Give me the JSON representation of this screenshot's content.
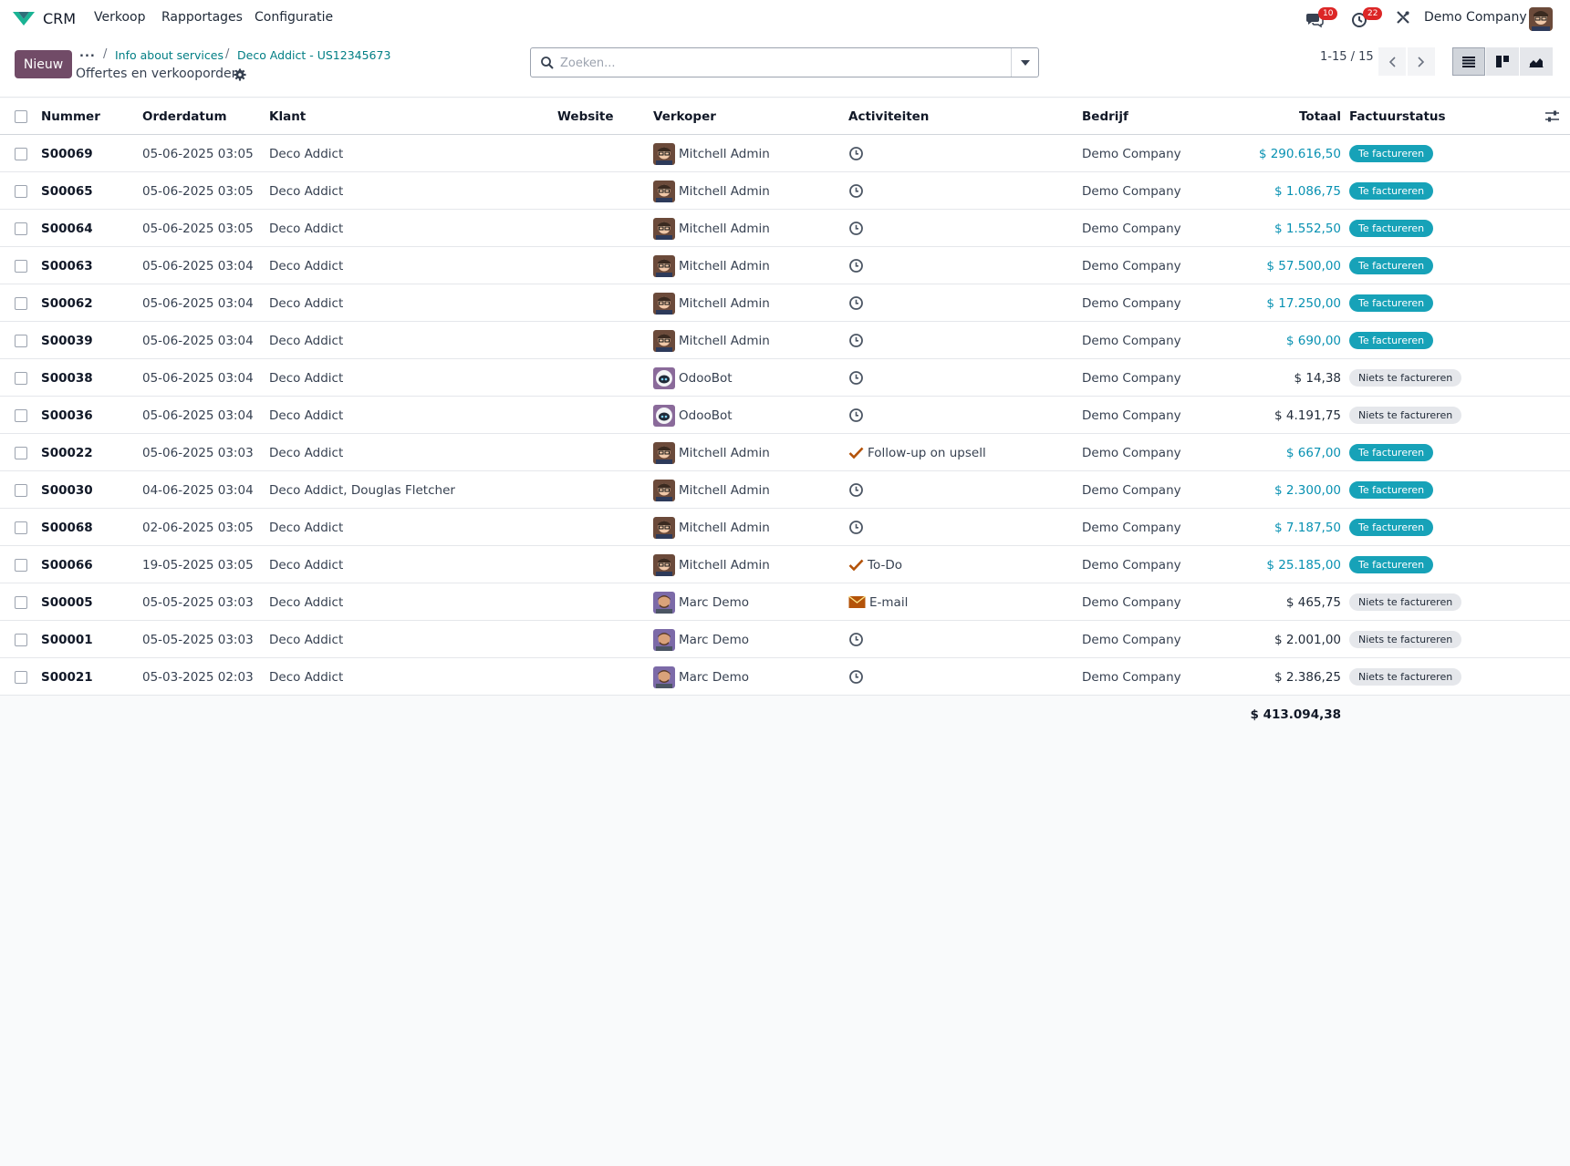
{
  "app": {
    "name": "CRM",
    "menus": [
      "Verkoop",
      "Rapportages",
      "Configuratie"
    ],
    "messages_count": "10",
    "activities_count": "22",
    "company": "Demo Company"
  },
  "control": {
    "new_label": "Nieuw",
    "breadcrumb_dots": "...",
    "breadcrumbs": [
      "Info about services",
      "Deco Addict - US12345673"
    ],
    "title": "Offertes en verkooporders",
    "search_placeholder": "Zoeken...",
    "pager": "1-15 / 15"
  },
  "table": {
    "headers": {
      "number": "Nummer",
      "date": "Orderdatum",
      "customer": "Klant",
      "website": "Website",
      "salesperson": "Verkoper",
      "activities": "Activiteiten",
      "company": "Bedrijf",
      "total": "Totaal",
      "invoice_status": "Factuurstatus"
    },
    "rows": [
      {
        "number": "S00069",
        "date": "05-06-2025 03:05",
        "customer": "Deco Addict",
        "website": "",
        "salesperson": "Mitchell Admin",
        "avatar": "mitchell",
        "activity": "",
        "activity_icon": "clock-icon",
        "company": "Demo Company",
        "total": "$ 290.616,50",
        "status": "Te factureren",
        "status_type": "info"
      },
      {
        "number": "S00065",
        "date": "05-06-2025 03:05",
        "customer": "Deco Addict",
        "website": "",
        "salesperson": "Mitchell Admin",
        "avatar": "mitchell",
        "activity": "",
        "activity_icon": "clock-icon",
        "company": "Demo Company",
        "total": "$ 1.086,75",
        "status": "Te factureren",
        "status_type": "info"
      },
      {
        "number": "S00064",
        "date": "05-06-2025 03:05",
        "customer": "Deco Addict",
        "website": "",
        "salesperson": "Mitchell Admin",
        "avatar": "mitchell",
        "activity": "",
        "activity_icon": "clock-icon",
        "company": "Demo Company",
        "total": "$ 1.552,50",
        "status": "Te factureren",
        "status_type": "info"
      },
      {
        "number": "S00063",
        "date": "05-06-2025 03:04",
        "customer": "Deco Addict",
        "website": "",
        "salesperson": "Mitchell Admin",
        "avatar": "mitchell",
        "activity": "",
        "activity_icon": "clock-icon",
        "company": "Demo Company",
        "total": "$ 57.500,00",
        "status": "Te factureren",
        "status_type": "info"
      },
      {
        "number": "S00062",
        "date": "05-06-2025 03:04",
        "customer": "Deco Addict",
        "website": "",
        "salesperson": "Mitchell Admin",
        "avatar": "mitchell",
        "activity": "",
        "activity_icon": "clock-icon",
        "company": "Demo Company",
        "total": "$ 17.250,00",
        "status": "Te factureren",
        "status_type": "info"
      },
      {
        "number": "S00039",
        "date": "05-06-2025 03:04",
        "customer": "Deco Addict",
        "website": "",
        "salesperson": "Mitchell Admin",
        "avatar": "mitchell",
        "activity": "",
        "activity_icon": "clock-icon",
        "company": "Demo Company",
        "total": "$ 690,00",
        "status": "Te factureren",
        "status_type": "info"
      },
      {
        "number": "S00038",
        "date": "05-06-2025 03:04",
        "customer": "Deco Addict",
        "website": "",
        "salesperson": "OdooBot",
        "avatar": "odoobot",
        "activity": "",
        "activity_icon": "clock-icon",
        "company": "Demo Company",
        "total": "$ 14,38",
        "status": "Niets te factureren",
        "status_type": "neutral"
      },
      {
        "number": "S00036",
        "date": "05-06-2025 03:04",
        "customer": "Deco Addict",
        "website": "",
        "salesperson": "OdooBot",
        "avatar": "odoobot",
        "activity": "",
        "activity_icon": "clock-icon",
        "company": "Demo Company",
        "total": "$ 4.191,75",
        "status": "Niets te factureren",
        "status_type": "neutral"
      },
      {
        "number": "S00022",
        "date": "05-06-2025 03:03",
        "customer": "Deco Addict",
        "website": "",
        "salesperson": "Mitchell Admin",
        "avatar": "mitchell",
        "activity": "Follow-up on upsell",
        "activity_icon": "check-icon",
        "company": "Demo Company",
        "total": "$ 667,00",
        "status": "Te factureren",
        "status_type": "info"
      },
      {
        "number": "S00030",
        "date": "04-06-2025 03:04",
        "customer": "Deco Addict, Douglas Fletcher",
        "website": "",
        "salesperson": "Mitchell Admin",
        "avatar": "mitchell",
        "activity": "",
        "activity_icon": "clock-icon",
        "company": "Demo Company",
        "total": "$ 2.300,00",
        "status": "Te factureren",
        "status_type": "info"
      },
      {
        "number": "S00068",
        "date": "02-06-2025 03:05",
        "customer": "Deco Addict",
        "website": "",
        "salesperson": "Mitchell Admin",
        "avatar": "mitchell",
        "activity": "",
        "activity_icon": "clock-icon",
        "company": "Demo Company",
        "total": "$ 7.187,50",
        "status": "Te factureren",
        "status_type": "info"
      },
      {
        "number": "S00066",
        "date": "19-05-2025 03:05",
        "customer": "Deco Addict",
        "website": "",
        "salesperson": "Mitchell Admin",
        "avatar": "mitchell",
        "activity": "To-Do",
        "activity_icon": "check-icon",
        "company": "Demo Company",
        "total": "$ 25.185,00",
        "status": "Te factureren",
        "status_type": "info"
      },
      {
        "number": "S00005",
        "date": "05-05-2025 03:03",
        "customer": "Deco Addict",
        "website": "",
        "salesperson": "Marc Demo",
        "avatar": "marc",
        "activity": "E-mail",
        "activity_icon": "envelope-icon",
        "company": "Demo Company",
        "total": "$ 465,75",
        "status": "Niets te factureren",
        "status_type": "neutral"
      },
      {
        "number": "S00001",
        "date": "05-05-2025 03:03",
        "customer": "Deco Addict",
        "website": "",
        "salesperson": "Marc Demo",
        "avatar": "marc",
        "activity": "",
        "activity_icon": "clock-icon",
        "company": "Demo Company",
        "total": "$ 2.001,00",
        "status": "Niets te factureren",
        "status_type": "neutral"
      },
      {
        "number": "S00021",
        "date": "05-03-2025 02:03",
        "customer": "Deco Addict",
        "website": "",
        "salesperson": "Marc Demo",
        "avatar": "marc",
        "activity": "",
        "activity_icon": "clock-icon",
        "company": "Demo Company",
        "total": "$ 2.386,25",
        "status": "Niets te factureren",
        "status_type": "neutral"
      }
    ],
    "footer_total": "$ 413.094,38"
  },
  "colors": {
    "brand": "#714B67",
    "link": "#017e84",
    "amount_to_invoice": "#0891b2",
    "badge_info": "#17a2b8",
    "badge_neutral": "#e5e7eb",
    "notification": "#dc2626",
    "activity_done": "#b45309"
  }
}
